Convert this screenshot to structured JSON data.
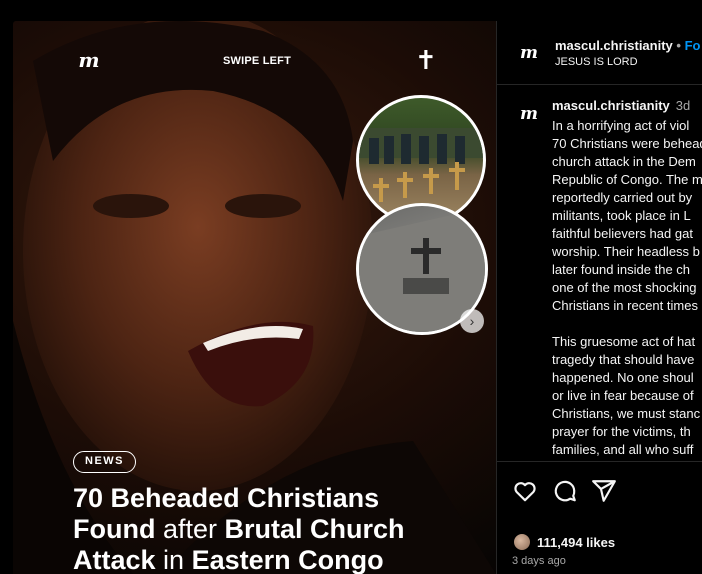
{
  "post": {
    "overlay_logo": "m",
    "swipe_label": "SWIPE LEFT",
    "cross_symbol": "✝",
    "next_arrow": "›",
    "news_badge": "NEWS",
    "headline": {
      "part1": "70 Beheaded Christians",
      "part2": "Found",
      "part3": " after ",
      "part4": "Brutal Church",
      "part5": "Attack",
      "part6": " in ",
      "part7": "Eastern Congo"
    }
  },
  "header": {
    "logo": "m",
    "username": "mascul.christianity",
    "dot": "•",
    "follow_label": "Fo",
    "subtitle": "JESUS IS LORD"
  },
  "caption": {
    "logo": "m",
    "username": "mascul.christianity",
    "time": "3d",
    "text": "In a horrifying act of viol\n70 Christians were beheadi\nchurch attack in the Dem\nRepublic of Congo. The m\nreportedly carried out by\nmilitants, took place in L\nfaithful believers had gat\nworship. Their headless b\nlater found inside the ch\none of the most shocking\nChristians in recent times\n\nThis gruesome act of hat\ntragedy that should have\nhappened. No one shoul\nor live in fear because of\nChristians, we must stanc\nprayer for the victims, th\nfamilies, and all who suff"
  },
  "actions": {
    "like_icon": "heart-icon",
    "comment_icon": "comment-icon",
    "share_icon": "share-icon",
    "likes": "111,494 likes",
    "time_ago": "3 days ago"
  },
  "colors": {
    "follow": "#0095f6",
    "muted": "#a8a8a8",
    "border": "#262626"
  }
}
